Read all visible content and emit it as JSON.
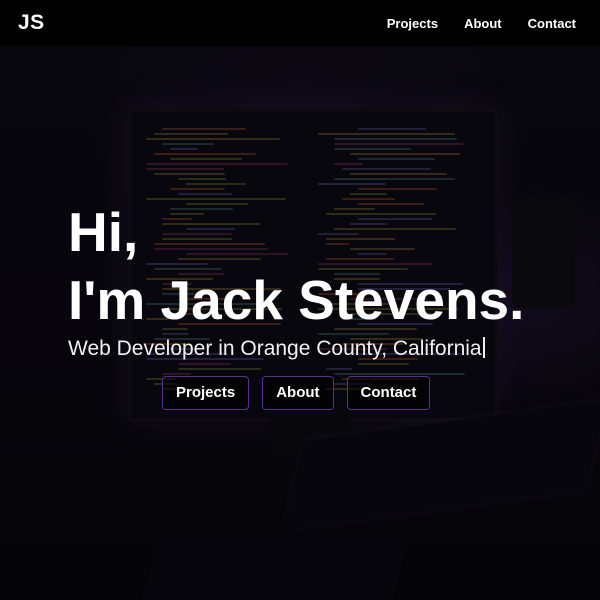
{
  "navbar": {
    "logo": "JS",
    "links": [
      "Projects",
      "About",
      "Contact"
    ]
  },
  "hero": {
    "greeting": "Hi,",
    "intro": "I'm Jack Stevens.",
    "subtitle": "Web Developer in Orange County, California",
    "buttons": [
      "Projects",
      "About",
      "Contact"
    ]
  },
  "colors": {
    "navbar_bg": "#000000",
    "button_border": "#5a2d90",
    "text": "#ffffff"
  }
}
